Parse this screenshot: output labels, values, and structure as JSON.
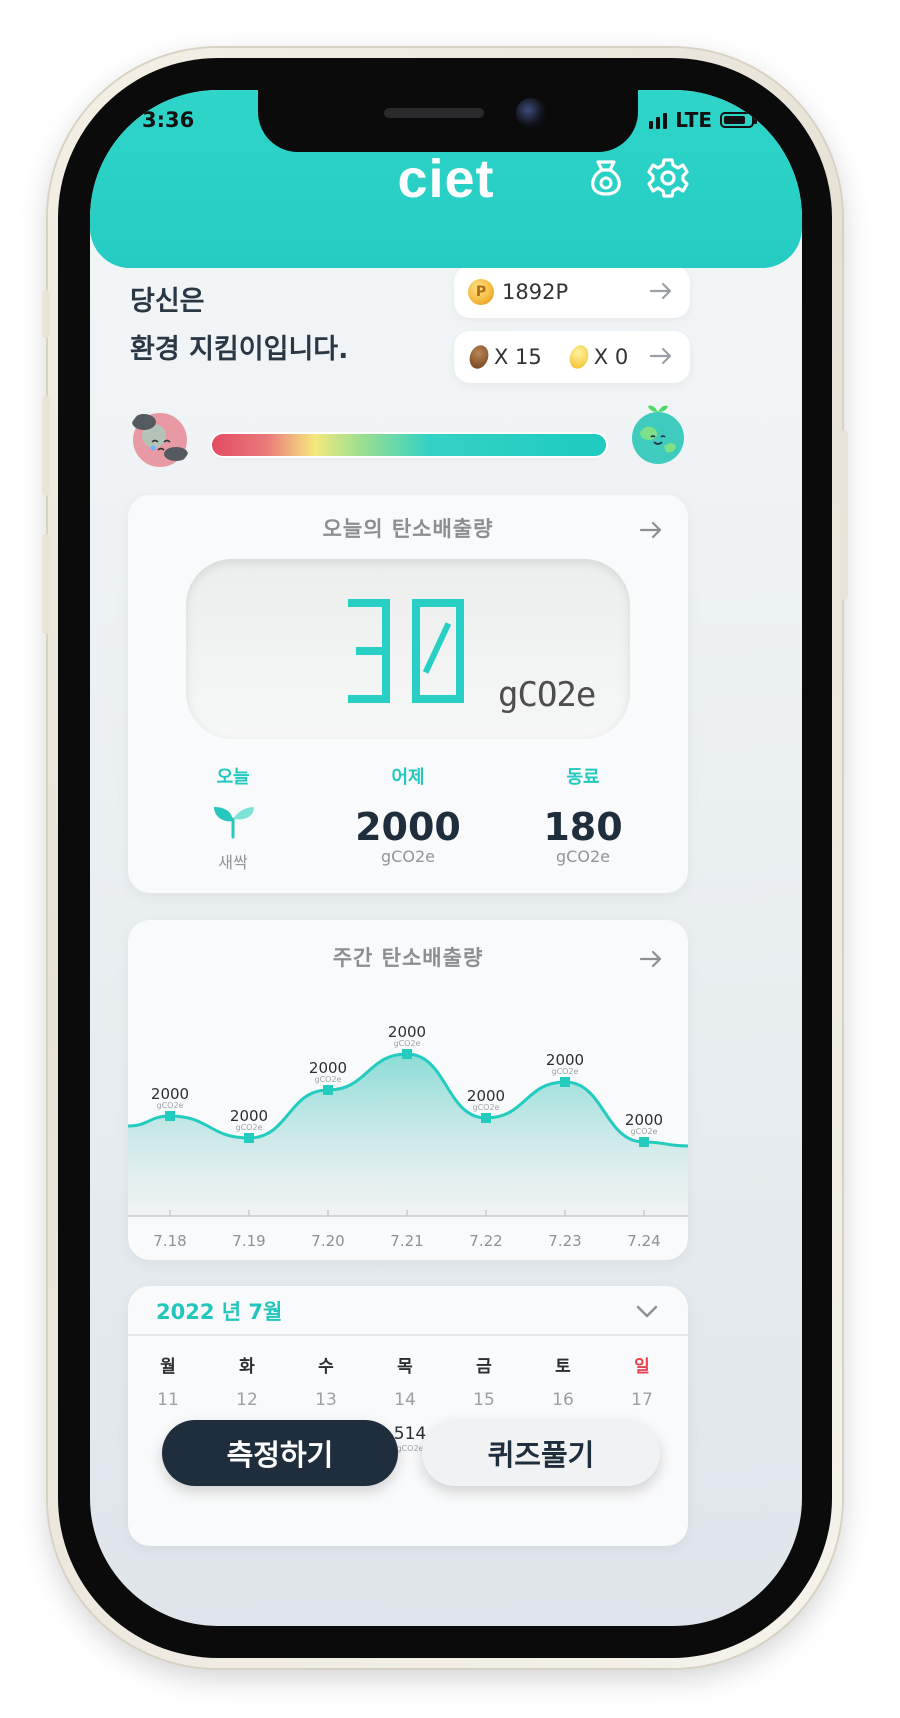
{
  "status_bar": {
    "time": "3:36",
    "network": "LTE"
  },
  "header": {
    "logo": "ciet",
    "pouch_icon": "money-pouch-icon",
    "settings_icon": "gear-icon"
  },
  "profile": {
    "status_line1": "당신은",
    "status_line2": "환경 지킴이입니다.",
    "points": "1892P",
    "brown_seed_count": "X 15",
    "gold_seed_count": "X 0",
    "progress_level": 0.62
  },
  "today_card": {
    "title": "오늘의 탄소배출량",
    "value": "30",
    "unit": "gCO2e",
    "stats": [
      {
        "label": "오늘",
        "value": "",
        "sub": "새싹"
      },
      {
        "label": "어제",
        "value": "2000",
        "sub": "gCO2e"
      },
      {
        "label": "동료",
        "value": "180",
        "sub": "gCO2e"
      }
    ]
  },
  "weekly_card": {
    "title": "주간 탄소배출량"
  },
  "chart_data": {
    "type": "area",
    "title": "주간 탄소배출량",
    "categories": [
      "7.18",
      "7.19",
      "7.20",
      "7.21",
      "7.22",
      "7.23",
      "7.24"
    ],
    "values": [
      2000,
      2000,
      2000,
      2000,
      2000,
      2000,
      2000
    ],
    "point_unit": "gCO2e",
    "grid": false,
    "line_color": "#24cbbf",
    "fill_color": "#7fd9d1"
  },
  "calendar": {
    "title": "2022 년 7월",
    "days": [
      "월",
      "화",
      "수",
      "목",
      "금",
      "토",
      "일"
    ],
    "dates": [
      "11",
      "12",
      "13",
      "14",
      "15",
      "16",
      "17"
    ],
    "partial_value": "514",
    "partial_unit": "gCO2e"
  },
  "actions": {
    "measure": "측정하기",
    "quiz": "퀴즈풀기"
  },
  "colors": {
    "accent": "#24cbbf",
    "dark": "#1f2e3d",
    "sunday": "#e8414f"
  }
}
